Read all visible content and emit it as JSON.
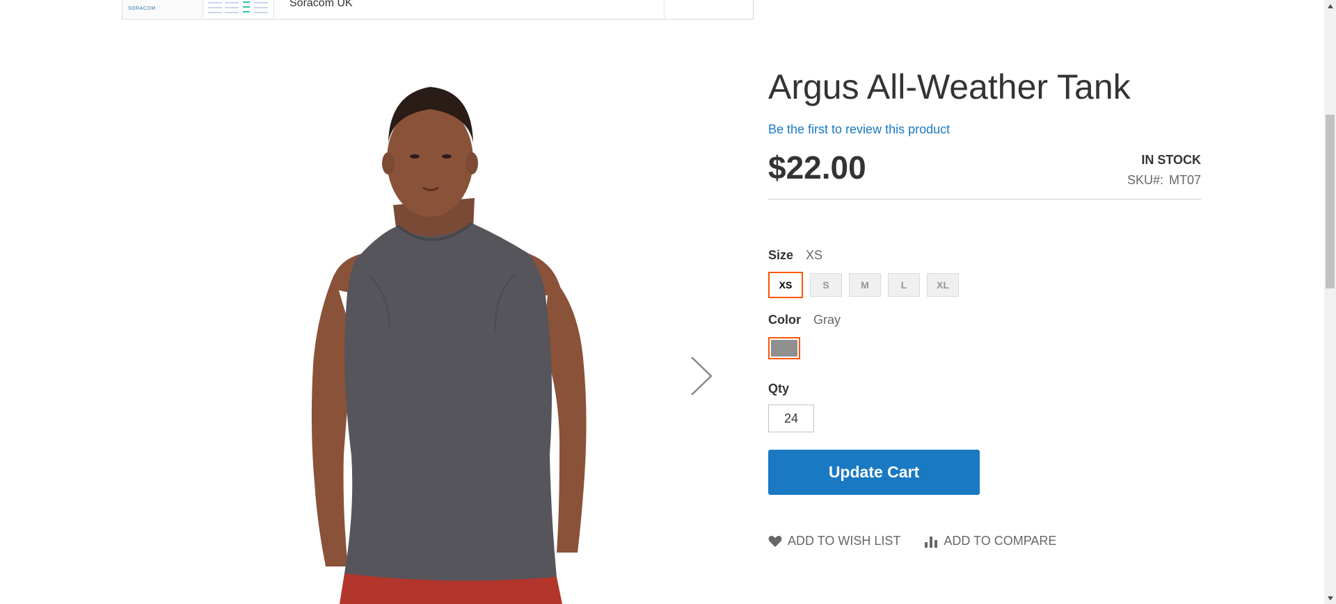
{
  "ad": {
    "logo_text": "SORACOM",
    "title": "Soracom UK"
  },
  "product": {
    "name": "Argus All-Weather Tank",
    "review_link": "Be the first to review this product",
    "price": "$22.00",
    "stock": "In stock",
    "sku_label": "SKU#:",
    "sku_value": "MT07"
  },
  "options": {
    "size": {
      "label": "Size",
      "selected": "XS",
      "values": [
        "XS",
        "S",
        "M",
        "L",
        "XL"
      ]
    },
    "color": {
      "label": "Color",
      "selected": "Gray",
      "swatch_color": "#8f8f8f"
    }
  },
  "qty": {
    "label": "Qty",
    "value": "24"
  },
  "buttons": {
    "update_cart": "Update Cart",
    "wishlist": "Add to Wish List",
    "compare": "Add to Compare"
  },
  "icons": {
    "next": "chevron-right-icon",
    "wishlist": "heart-icon",
    "compare": "bar-chart-icon"
  },
  "colors": {
    "accent": "#1979c3",
    "selected_border": "#ff5501"
  }
}
